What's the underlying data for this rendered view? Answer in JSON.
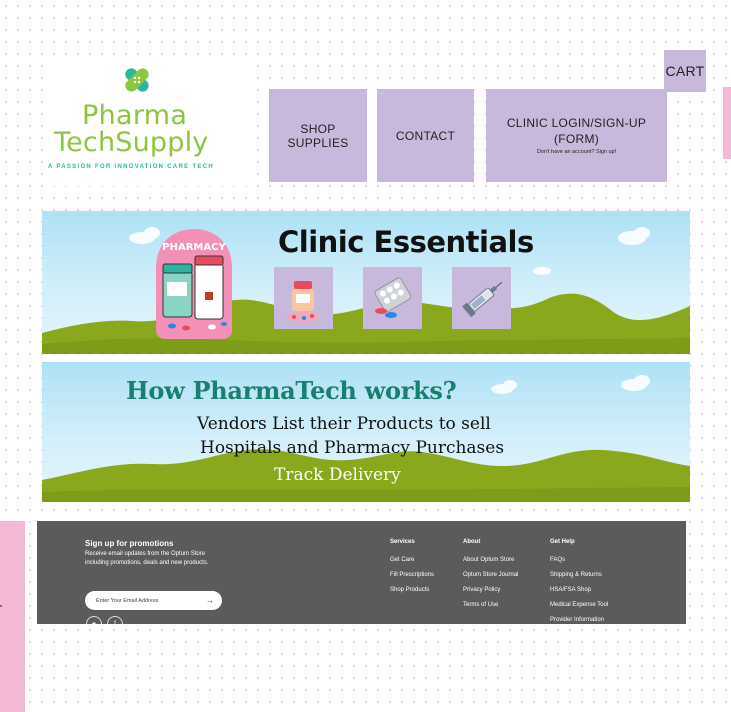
{
  "logo": {
    "line1": "Pharma",
    "line2": "TechSupply",
    "tagline": "A PASSION FOR INNOVATION CARE TECH"
  },
  "nav": {
    "shop": "SHOP SUPPLIES",
    "contact": "CONTACT",
    "login_line1": "CLINIC LOGIN/SIGN-UP",
    "login_line2": "(FORM)",
    "login_sub": "Don't have an account? Sign up!",
    "cart": "CART"
  },
  "banner1": {
    "title": "Clinic Essentials",
    "badge_text": "PHARMACY",
    "tiles": [
      "pill-bottles-icon",
      "blister-pack-icon",
      "syringe-icon"
    ]
  },
  "banner2": {
    "title": "How PharmaTech works?",
    "line1": "Vendors List their Products to sell",
    "line2": "Hospitals and Pharmacy Purchases",
    "line3": "Track Delivery"
  },
  "footer": {
    "signup_title": "Sign up for promotions",
    "signup_desc": "Receive email updates from the Optum Store including promotions, deals and new products.",
    "email_placeholder": "Enter Your Email Address",
    "columns": [
      {
        "heading": "Services",
        "links": [
          "Get Care",
          "Fill Prescriptions",
          "Shop Products"
        ]
      },
      {
        "heading": "About",
        "links": [
          "About Optum Store",
          "Optum Store Journal",
          "Privacy Policy",
          "Terms of Use"
        ]
      },
      {
        "heading": "Get Help",
        "links": [
          "FAQs",
          "Shipping & Returns",
          "HSA/FSA Shop",
          "Medical Expense Tool",
          "Provider Information"
        ]
      }
    ],
    "social": [
      "instagram-icon",
      "facebook-icon"
    ]
  },
  "colors": {
    "nav_purple": "#c7b8dc",
    "logo_green": "#8cc63f",
    "heading_teal": "#1a7f6e",
    "accent_pink": "#f3b8d6",
    "footer_gray": "#5b5b5b"
  }
}
